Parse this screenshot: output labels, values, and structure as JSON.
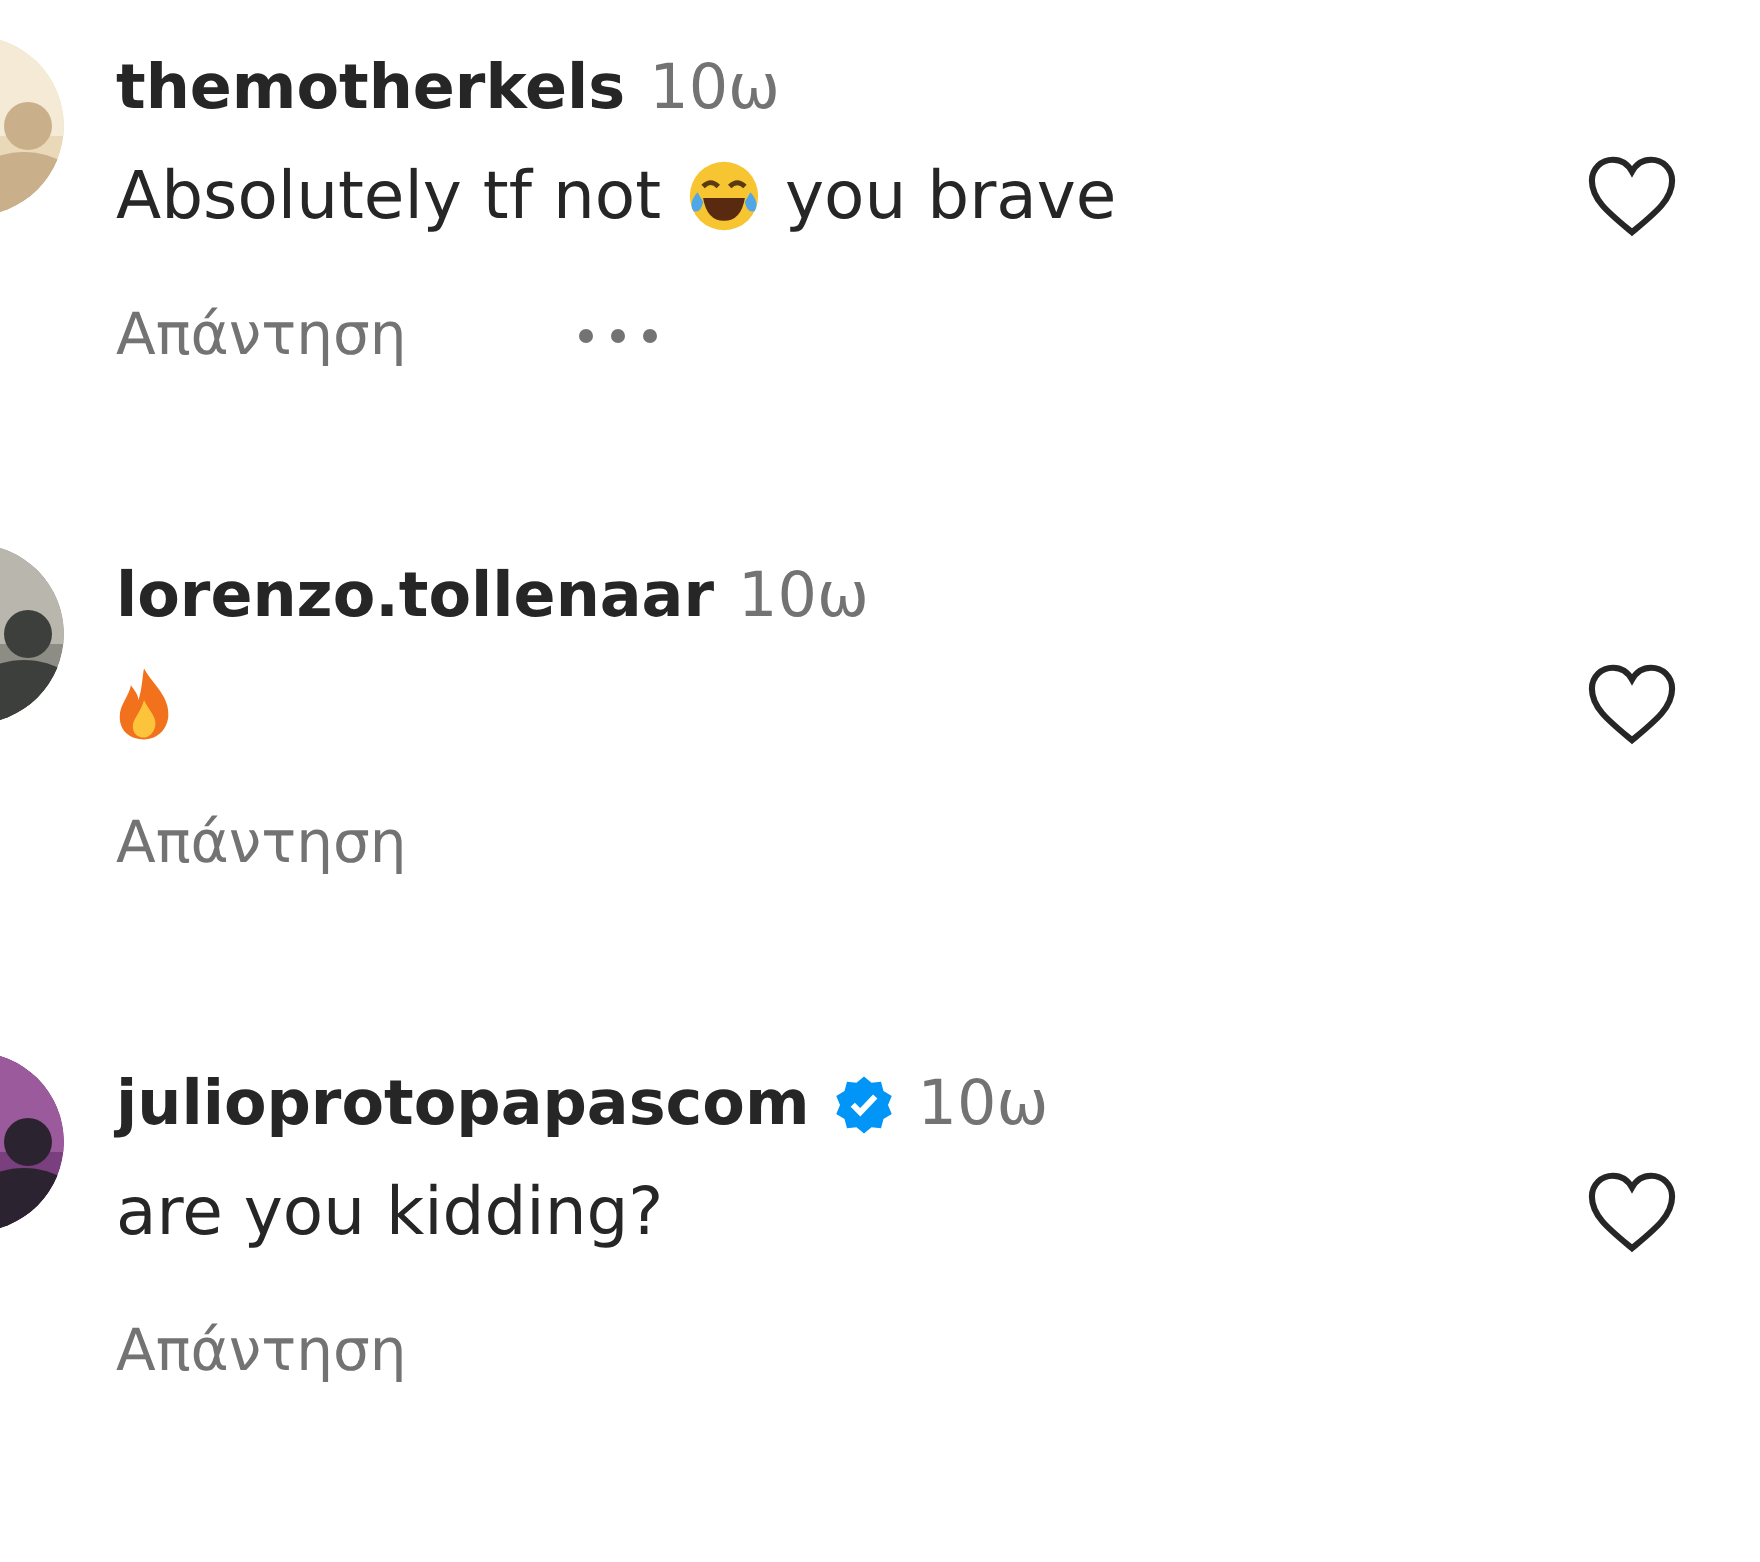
{
  "comments": [
    {
      "username": "themotherkels",
      "verified": false,
      "time": "10ω",
      "body": [
        {
          "kind": "text",
          "text": "Absolutely tf not"
        },
        {
          "kind": "laugh"
        },
        {
          "kind": "text",
          "text": "you brave"
        }
      ],
      "reply": "Απάντηση",
      "has_options": true
    },
    {
      "username": "lorenzo.tollenaar",
      "verified": false,
      "time": "10ω",
      "body": [
        {
          "kind": "fire"
        }
      ],
      "reply": "Απάντηση",
      "has_options": false
    },
    {
      "username": "julioprotopapascom",
      "verified": true,
      "time": "10ω",
      "body": [
        {
          "kind": "text",
          "text": "are you kidding?"
        }
      ],
      "reply": "Απάντηση",
      "has_options": false
    }
  ]
}
